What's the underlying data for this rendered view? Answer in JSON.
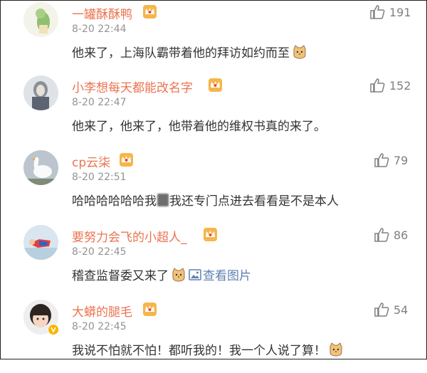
{
  "comments": [
    {
      "name": "一罐酥酥鸭",
      "time": "8-20 22:44",
      "likes": "191",
      "text": "他来了，上海队霸带着他的拜访如约而至",
      "emoji": "cat-face-icon"
    },
    {
      "name": "小李想每天都能改名字",
      "time": "8-20 22:47",
      "likes": "152",
      "text": "他来了，他来了，他带着他的维权书真的来了。"
    },
    {
      "name": "cp云柒",
      "time": "8-20 22:51",
      "likes": "79",
      "text_before": "哈哈哈哈哈哈我",
      "text_after": "我还专门点进去看看是不是本人"
    },
    {
      "name": "要努力会飞的小超人_",
      "time": "8-20 22:45",
      "likes": "86",
      "text": "稽查监督委又来了",
      "link": "查看图片",
      "emoji": "cat-face-icon"
    },
    {
      "name": "大蟒的腿毛",
      "time": "8-20 22:45",
      "likes": "54",
      "text": "我说不怕就不怕！都听我的！我一个人说了算！",
      "emoji": "cat-face-icon"
    }
  ],
  "colors": {
    "name": "#eb7350",
    "time": "#939393",
    "link": "#5d80b1",
    "crown": "#f5b64a"
  }
}
